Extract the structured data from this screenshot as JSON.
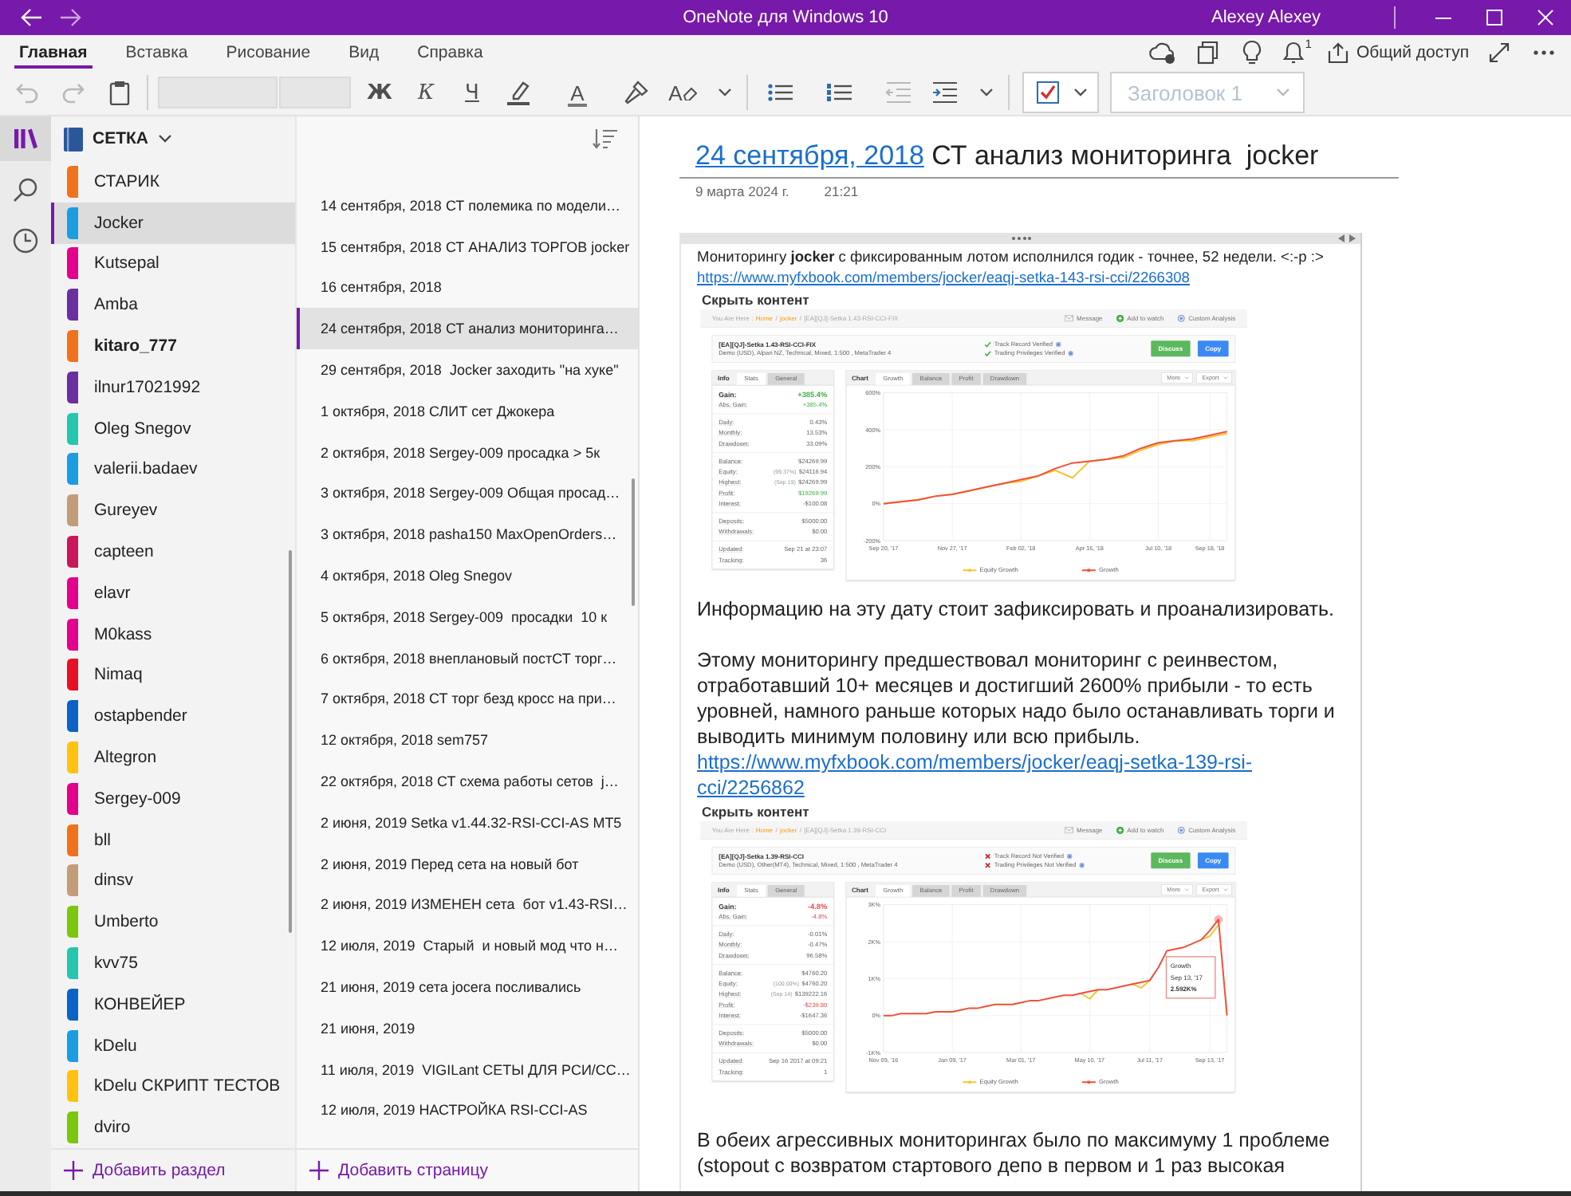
{
  "window": {
    "title": "OneNote для Windows 10",
    "user": "Alexey Alexey"
  },
  "ribbon": {
    "tabs": [
      {
        "label": "Главная",
        "selected": true
      },
      {
        "label": "Вставка",
        "selected": false
      },
      {
        "label": "Рисование",
        "selected": false
      },
      {
        "label": "Вид",
        "selected": false
      },
      {
        "label": "Справка",
        "selected": false
      }
    ],
    "notifications": "1",
    "share": "Общий доступ"
  },
  "toolbar": {
    "groups": [
      [
        {
          "kind": "undo",
          "disabled": true
        },
        {
          "kind": "redo",
          "disabled": true
        },
        {
          "kind": "paste",
          "disabled": false
        }
      ],
      [
        {
          "kind": "font-field",
          "disabled": true
        },
        {
          "kind": "size-field",
          "disabled": true
        },
        {
          "kind": "bold",
          "glyph": "Ж",
          "disabled": false
        },
        {
          "kind": "italic",
          "glyph": "К",
          "disabled": false
        },
        {
          "kind": "underline",
          "glyph": "Ч",
          "disabled": false
        },
        {
          "kind": "highlight",
          "disabled": false
        },
        {
          "kind": "font-color",
          "glyph": "A",
          "disabled": false
        },
        {
          "kind": "format-painter",
          "disabled": false
        },
        {
          "kind": "clear-format",
          "glyph": "A",
          "disabled": false
        },
        {
          "kind": "more",
          "disabled": false
        }
      ],
      [
        {
          "kind": "bullets",
          "disabled": false
        },
        {
          "kind": "numbering",
          "disabled": false
        },
        {
          "kind": "outdent",
          "disabled": true
        },
        {
          "kind": "indent",
          "disabled": false
        },
        {
          "kind": "more",
          "disabled": false
        }
      ],
      [
        {
          "kind": "tag",
          "disabled": false
        },
        {
          "kind": "style",
          "value": "Заголовок 1",
          "disabled": true
        }
      ]
    ]
  },
  "rail": [
    {
      "kind": "notebooks",
      "selected": true
    },
    {
      "kind": "search",
      "selected": false
    },
    {
      "kind": "recent",
      "selected": false
    }
  ],
  "notebook": "СЕТКА",
  "sections": [
    {
      "name": "СТАРИК",
      "color": "#f2711c",
      "selected": false,
      "unread": false
    },
    {
      "name": "Jocker",
      "color": "#1b9de2",
      "selected": true,
      "unread": false
    },
    {
      "name": "Kutsepal",
      "color": "#e3008c",
      "selected": false,
      "unread": false
    },
    {
      "name": "Amba",
      "color": "#6b2fa0",
      "selected": false,
      "unread": false
    },
    {
      "name": "kitaro_777",
      "color": "#f2711c",
      "selected": false,
      "unread": true
    },
    {
      "name": "ilnur17021992",
      "color": "#6b2fa0",
      "selected": false,
      "unread": false
    },
    {
      "name": "Oleg Snegov",
      "color": "#26c6b0",
      "selected": false,
      "unread": false
    },
    {
      "name": "valerii.badaev",
      "color": "#1b9de2",
      "selected": false,
      "unread": false
    },
    {
      "name": "Gureyev",
      "color": "#c39d78",
      "selected": false,
      "unread": false
    },
    {
      "name": "capteen",
      "color": "#c8175a",
      "selected": false,
      "unread": false
    },
    {
      "name": "elavr",
      "color": "#e3008c",
      "selected": false,
      "unread": false
    },
    {
      "name": "M0kass",
      "color": "#e3008c",
      "selected": false,
      "unread": false
    },
    {
      "name": "Nimaq",
      "color": "#e81123",
      "selected": false,
      "unread": false
    },
    {
      "name": "ostapbender",
      "color": "#0b63c5",
      "selected": false,
      "unread": false
    },
    {
      "name": "Altegron",
      "color": "#ffc30f",
      "selected": false,
      "unread": false
    },
    {
      "name": "Sergey-009",
      "color": "#e3008c",
      "selected": false,
      "unread": false
    },
    {
      "name": "bll",
      "color": "#f2711c",
      "selected": false,
      "unread": false
    },
    {
      "name": "dinsv",
      "color": "#c39d78",
      "selected": false,
      "unread": false
    },
    {
      "name": "Umberto",
      "color": "#7ac70c",
      "selected": false,
      "unread": false
    },
    {
      "name": "kvv75",
      "color": "#26c6b0",
      "selected": false,
      "unread": false
    },
    {
      "name": "КОНВЕЙЕР",
      "color": "#0b63c5",
      "selected": false,
      "unread": false
    },
    {
      "name": "kDelu",
      "color": "#1b9de2",
      "selected": false,
      "unread": false
    },
    {
      "name": "kDelu СКРИПТ ТЕСТОВ",
      "color": "#ffc30f",
      "selected": false,
      "unread": false
    },
    {
      "name": "dviro",
      "color": "#7ac70c",
      "selected": false,
      "unread": false
    }
  ],
  "sections_footer": "Добавить раздел",
  "pages": [
    {
      "title": "14 сентября, 2018 СТ полемика по модели…",
      "selected": false
    },
    {
      "title": "15 сентября, 2018 СТ АНАЛИЗ ТОРГОВ jocker",
      "selected": false
    },
    {
      "title": "16 сентября, 2018",
      "selected": false
    },
    {
      "title": "24 сентября, 2018 СТ анализ мониторинга…",
      "selected": true
    },
    {
      "title": "29 сентября, 2018  Jocker заходить \"на хуке\"",
      "selected": false
    },
    {
      "title": "1 октября, 2018 СЛИТ сет Джокера",
      "selected": false
    },
    {
      "title": "2 октября, 2018 Sergey-009 просадка > 5к",
      "selected": false
    },
    {
      "title": "3 октября, 2018 Sergey-009 Общая просад…",
      "selected": false
    },
    {
      "title": "3 октября, 2018 pasha150 MaxOpenOrders…",
      "selected": false
    },
    {
      "title": "4 октября, 2018 Oleg Snegov",
      "selected": false
    },
    {
      "title": "5 октября, 2018 Sergey-009  просадки  10 к",
      "selected": false
    },
    {
      "title": "6 октября, 2018 внеплановый постСТ торг…",
      "selected": false
    },
    {
      "title": "7 октября, 2018 СТ торг безд кросс на при…",
      "selected": false
    },
    {
      "title": "12 октября, 2018 sem757",
      "selected": false
    },
    {
      "title": "22 октября, 2018 СТ схема работы сетов  j…",
      "selected": false
    },
    {
      "title": "2 июня, 2019 Setka v1.44.32-RSI-CCI-AS MT5",
      "selected": false
    },
    {
      "title": "2 июня, 2019 Перед сета на новый бот",
      "selected": false
    },
    {
      "title": "2 июня, 2019 ИЗМЕНЕН сета  бот v1.43-RSI…",
      "selected": false
    },
    {
      "title": "12 июля, 2019  Старый  и новый мод что н…",
      "selected": false
    },
    {
      "title": "21 июня, 2019 сета jocera посливались",
      "selected": false
    },
    {
      "title": "21 июня, 2019",
      "selected": false
    },
    {
      "title": "11 июля, 2019  VIGILant СЕТЫ ДЛЯ РСИ/СС…",
      "selected": false
    },
    {
      "title": "12 июля, 2019 НАСТРОЙКА RSI-CCI-AS",
      "selected": false
    }
  ],
  "pages_footer": "Добавить страницу",
  "page": {
    "title_link": "24 сентября, 2018",
    "title": " СТ анализ мониторинга  jocker",
    "date": "9 марта 2024 г.",
    "time": "21:21",
    "blocks": [
      {
        "kind": "small",
        "text": "Мониторингу **jocker** с фиксированным лотом исполнился годик - точнее, 52 недели. <:-p :>"
      },
      {
        "kind": "small-link",
        "text": "https://www.myfxbook.com/members/jocker/eaqj-setka-143-rsi-cci/2266308"
      },
      {
        "kind": "toggle",
        "text": "Скрыть контент"
      },
      {
        "kind": "screenshot",
        "shot": {
          "breadcrumb": {
            "label": "You Are Here :",
            "items": [
              {
                "text": "Home",
                "link": true
              },
              {
                "text": "/",
                "link": false
              },
              {
                "text": "jocker",
                "link": true
              },
              {
                "text": "/",
                "link": false
              },
              {
                "text": "[EA][QJ]-Setka 1.43-RSI-CCI-FIX",
                "link": false
              }
            ]
          },
          "actions": [
            {
              "kind": "message",
              "label": "Message"
            },
            {
              "kind": "watch",
              "label": "Add to watch"
            },
            {
              "kind": "analysis",
              "label": "Custom Analysis"
            }
          ],
          "system": {
            "name": "[EA][QJ]-Setka 1.43-RSI-CCI-FIX",
            "details": "Demo (USD), Alpari NZ, Technical, Mixed, 1:500 , MetaTrader 4"
          },
          "verification": [
            {
              "label": "Track Record Verified",
              "verified": true
            },
            {
              "label": "Trading Privileges Verified",
              "verified": true
            }
          ],
          "buttons": [
            {
              "kind": "discuss",
              "label": "Discuss"
            },
            {
              "kind": "copy",
              "label": "Copy"
            }
          ],
          "info": {
            "title": "Info",
            "tabs": [
              {
                "label": "Stats",
                "selected": true
              },
              {
                "label": "General",
                "selected": false
              }
            ],
            "groups": [
              [
                {
                  "kind": "main-up",
                  "label": "Gain:",
                  "value": "+385.4%"
                },
                {
                  "kind": "up",
                  "label": "Abs. Gain:",
                  "value": "+385.4%"
                }
              ],
              [
                {
                  "kind": "plain",
                  "label": "Daily:",
                  "value": "0.43%"
                },
                {
                  "kind": "plain",
                  "label": "Monthly:",
                  "value": "13.53%"
                },
                {
                  "kind": "plain",
                  "label": "Drawdown:",
                  "value": "33.09%"
                }
              ],
              [
                {
                  "kind": "plain",
                  "label": "Balance:",
                  "value": "$24269.99"
                },
                {
                  "kind": "plain",
                  "label": "Equity:",
                  "note": "(99.37%)",
                  "value": "$24116.94"
                },
                {
                  "kind": "plain",
                  "label": "Highest:",
                  "note": "(Sep 19)",
                  "value": "$24269.99"
                },
                {
                  "kind": "up",
                  "label": "Profit:",
                  "value": "$19269.99"
                },
                {
                  "kind": "plain",
                  "label": "Interest:",
                  "value": "-$100.08"
                }
              ],
              [
                {
                  "kind": "plain",
                  "label": "Deposits:",
                  "value": "$5000.00"
                },
                {
                  "kind": "plain",
                  "label": "Withdrawals:",
                  "value": "$0.00"
                }
              ],
              [
                {
                  "kind": "plain",
                  "label": "Updated:",
                  "value": "Sep 21 at 23:07"
                },
                {
                  "kind": "plain",
                  "label": "Tracking:",
                  "value": "36"
                }
              ]
            ]
          },
          "chart": {
            "title": "Chart",
            "tabs": [
              {
                "label": "Growth",
                "selected": true
              },
              {
                "label": "Balance",
                "selected": false
              },
              {
                "label": "Profit",
                "selected": false
              },
              {
                "label": "Drawdown",
                "selected": false
              }
            ],
            "menus": [
              "More",
              "Export"
            ],
            "chart_data": {
              "type": "line",
              "grid": true,
              "categories": [
                "Sep 20, '17",
                null,
                null,
                null,
                "Nov 27, '17",
                null,
                null,
                null,
                "Feb 02, '18",
                null,
                null,
                null,
                "Apr 16, '18",
                null,
                null,
                null,
                "Jul 10, '18",
                null,
                null,
                "Sep 18, '18",
                null
              ],
              "series": [
                {
                  "name": "Equity Growth",
                  "color": "#f7c531",
                  "values": [
                    0,
                    10,
                    20,
                    40,
                    50,
                    70,
                    90,
                    110,
                    120,
                    150,
                    180,
                    140,
                    230,
                    240,
                    250,
                    290,
                    320,
                    340,
                    340,
                    360,
                    380
                  ]
                },
                {
                  "name": "Growth",
                  "color": "#f0503a",
                  "values": [
                    0,
                    10,
                    20,
                    40,
                    50,
                    70,
                    90,
                    110,
                    130,
                    150,
                    190,
                    220,
                    230,
                    240,
                    260,
                    300,
                    330,
                    340,
                    350,
                    370,
                    390
                  ]
                }
              ],
              "ylim": [
                -200,
                600
              ],
              "yticks": [
                {
                  "value": 600,
                  "label": "600%"
                },
                {
                  "value": 400,
                  "label": "400%"
                },
                {
                  "value": 200,
                  "label": "200%"
                },
                {
                  "value": 0,
                  "label": "0%"
                },
                {
                  "value": -200,
                  "label": "-200%"
                }
              ]
            }
          }
        }
      },
      {
        "kind": "text",
        "text": "Информацию на эту дату стоит зафиксировать и проанализировать."
      },
      {
        "kind": "paragraph",
        "text": "Этому мониторингу предшествовал мониторинг с реинвестом, отработавший 10+ месяцев и достигший 2600% прибыли - то есть уровней, намного раньше которых надо было останавливать торги и выводить минимум половину или всю прибыль."
      },
      {
        "kind": "link",
        "text": "https://www.myfxbook.com/members/jocker/eaqj-setka-139-rsi-cci/2256862"
      },
      {
        "kind": "toggle",
        "text": "Скрыть контент"
      },
      {
        "kind": "screenshot",
        "shot": {
          "breadcrumb": {
            "label": "You Are Here :",
            "items": [
              {
                "text": "Home",
                "link": true
              },
              {
                "text": "/",
                "link": false
              },
              {
                "text": "jocker",
                "link": true
              },
              {
                "text": "/",
                "link": false
              },
              {
                "text": "[EA][QJ]-Setka 1.39-RSI-CCI",
                "link": false
              }
            ]
          },
          "actions": [
            {
              "kind": "message",
              "label": "Message"
            },
            {
              "kind": "watch",
              "label": "Add to watch"
            },
            {
              "kind": "analysis",
              "label": "Custom Analysis"
            }
          ],
          "system": {
            "name": "[EA][QJ]-Setka 1.39-RSI-CCI",
            "details": "Demo (USD), Other(MT4), Technical, Mixed, 1:500 , MetaTrader 4"
          },
          "verification": [
            {
              "label": "Track Record Not Verified",
              "verified": false
            },
            {
              "label": "Trading Privileges Not Verified",
              "verified": false
            }
          ],
          "buttons": [
            {
              "kind": "discuss",
              "label": "Discuss"
            },
            {
              "kind": "copy",
              "label": "Copy"
            }
          ],
          "info": {
            "title": "Info",
            "tabs": [
              {
                "label": "Stats",
                "selected": true
              },
              {
                "label": "General",
                "selected": false
              }
            ],
            "groups": [
              [
                {
                  "kind": "main-down",
                  "label": "Gain:",
                  "value": "-4.8%"
                },
                {
                  "kind": "down",
                  "label": "Abs. Gain:",
                  "value": "-4.8%"
                }
              ],
              [
                {
                  "kind": "plain",
                  "label": "Daily:",
                  "value": "-0.01%"
                },
                {
                  "kind": "plain",
                  "label": "Monthly:",
                  "value": "-0.47%"
                },
                {
                  "kind": "plain",
                  "label": "Drawdown:",
                  "value": "96.58%"
                }
              ],
              [
                {
                  "kind": "plain",
                  "label": "Balance:",
                  "value": "$4760.20"
                },
                {
                  "kind": "plain",
                  "label": "Equity:",
                  "note": "(100.00%)",
                  "value": "$4760.20"
                },
                {
                  "kind": "plain",
                  "label": "Highest:",
                  "note": "(Sep 14)",
                  "value": "$139222.16"
                },
                {
                  "kind": "down",
                  "label": "Profit:",
                  "value": "-$239.80"
                },
                {
                  "kind": "plain",
                  "label": "Interest:",
                  "value": "-$1647.36"
                }
              ],
              [
                {
                  "kind": "plain",
                  "label": "Deposits:",
                  "value": "$5000.00"
                },
                {
                  "kind": "plain",
                  "label": "Withdrawals:",
                  "value": "$0.00"
                }
              ],
              [
                {
                  "kind": "plain",
                  "label": "Updated:",
                  "value": "Sep 16 2017 at 09:21"
                },
                {
                  "kind": "plain",
                  "label": "Tracking:",
                  "value": "1"
                }
              ]
            ]
          },
          "chart": {
            "title": "Chart",
            "tabs": [
              {
                "label": "Growth",
                "selected": true
              },
              {
                "label": "Balance",
                "selected": false
              },
              {
                "label": "Profit",
                "selected": false
              },
              {
                "label": "Drawdown",
                "selected": false
              }
            ],
            "menus": [
              "More",
              "Export"
            ],
            "chart_data": {
              "type": "line",
              "grid": true,
              "categories": [
                "Nov 09, '16",
                null,
                null,
                null,
                null,
                null,
                null,
                null,
                "Jan 09, '17",
                null,
                null,
                null,
                null,
                null,
                null,
                null,
                "Mar 01, '17",
                null,
                null,
                null,
                null,
                null,
                null,
                null,
                "May 10, '17",
                null,
                null,
                null,
                null,
                null,
                null,
                "Jul 11, '17",
                null,
                null,
                null,
                null,
                null,
                null,
                "Sep 13, '17",
                null,
                null
              ],
              "series": [
                {
                  "name": "Equity Growth",
                  "color": "#f7c531",
                  "values": [
                    null,
                    null,
                    null,
                    null,
                    null,
                    null,
                    null,
                    null,
                    null,
                    null,
                    null,
                    null,
                    null,
                    null,
                    null,
                    null,
                    null,
                    null,
                    null,
                    null,
                    null,
                    null,
                    null,
                    600,
                    450,
                    700,
                    null,
                    null,
                    null,
                    850,
                    750,
                    950,
                    null,
                    null,
                    null,
                    null,
                    null,
                    2050,
                    2150,
                    2450,
                    null
                  ]
                },
                {
                  "name": "Growth",
                  "color": "#f0503a",
                  "values": [
                    0,
                    0,
                    50,
                    50,
                    50,
                    50,
                    100,
                    100,
                    100,
                    150,
                    200,
                    200,
                    250,
                    300,
                    300,
                    300,
                    350,
                    400,
                    400,
                    450,
                    500,
                    550,
                    550,
                    600,
                    650,
                    700,
                    700,
                    750,
                    800,
                    850,
                    900,
                    950,
                    1300,
                    1750,
                    1800,
                    1850,
                    1950,
                    2050,
                    2300,
                    2600,
                    0
                  ]
                }
              ],
              "ylim": [
                -1000,
                3000
              ],
              "yticks": [
                {
                  "value": 3000,
                  "label": "3K%"
                },
                {
                  "value": 2000,
                  "label": "2K%"
                },
                {
                  "value": 1000,
                  "label": "1K%"
                },
                {
                  "value": 0,
                  "label": "0%"
                },
                {
                  "value": -1000,
                  "label": "-1K%"
                }
              ],
              "annotations": [
                {
                  "text": [
                    "Growth",
                    "Sep 13, '17",
                    "2.592K%"
                  ]
                }
              ]
            }
          }
        }
      },
      {
        "kind": "paragraph",
        "text": "В обеих агрессивных мониторингах было по максимуму 1 проблеме (stopout с возвратом стартового депо в первом и 1 раз высокая"
      }
    ]
  }
}
